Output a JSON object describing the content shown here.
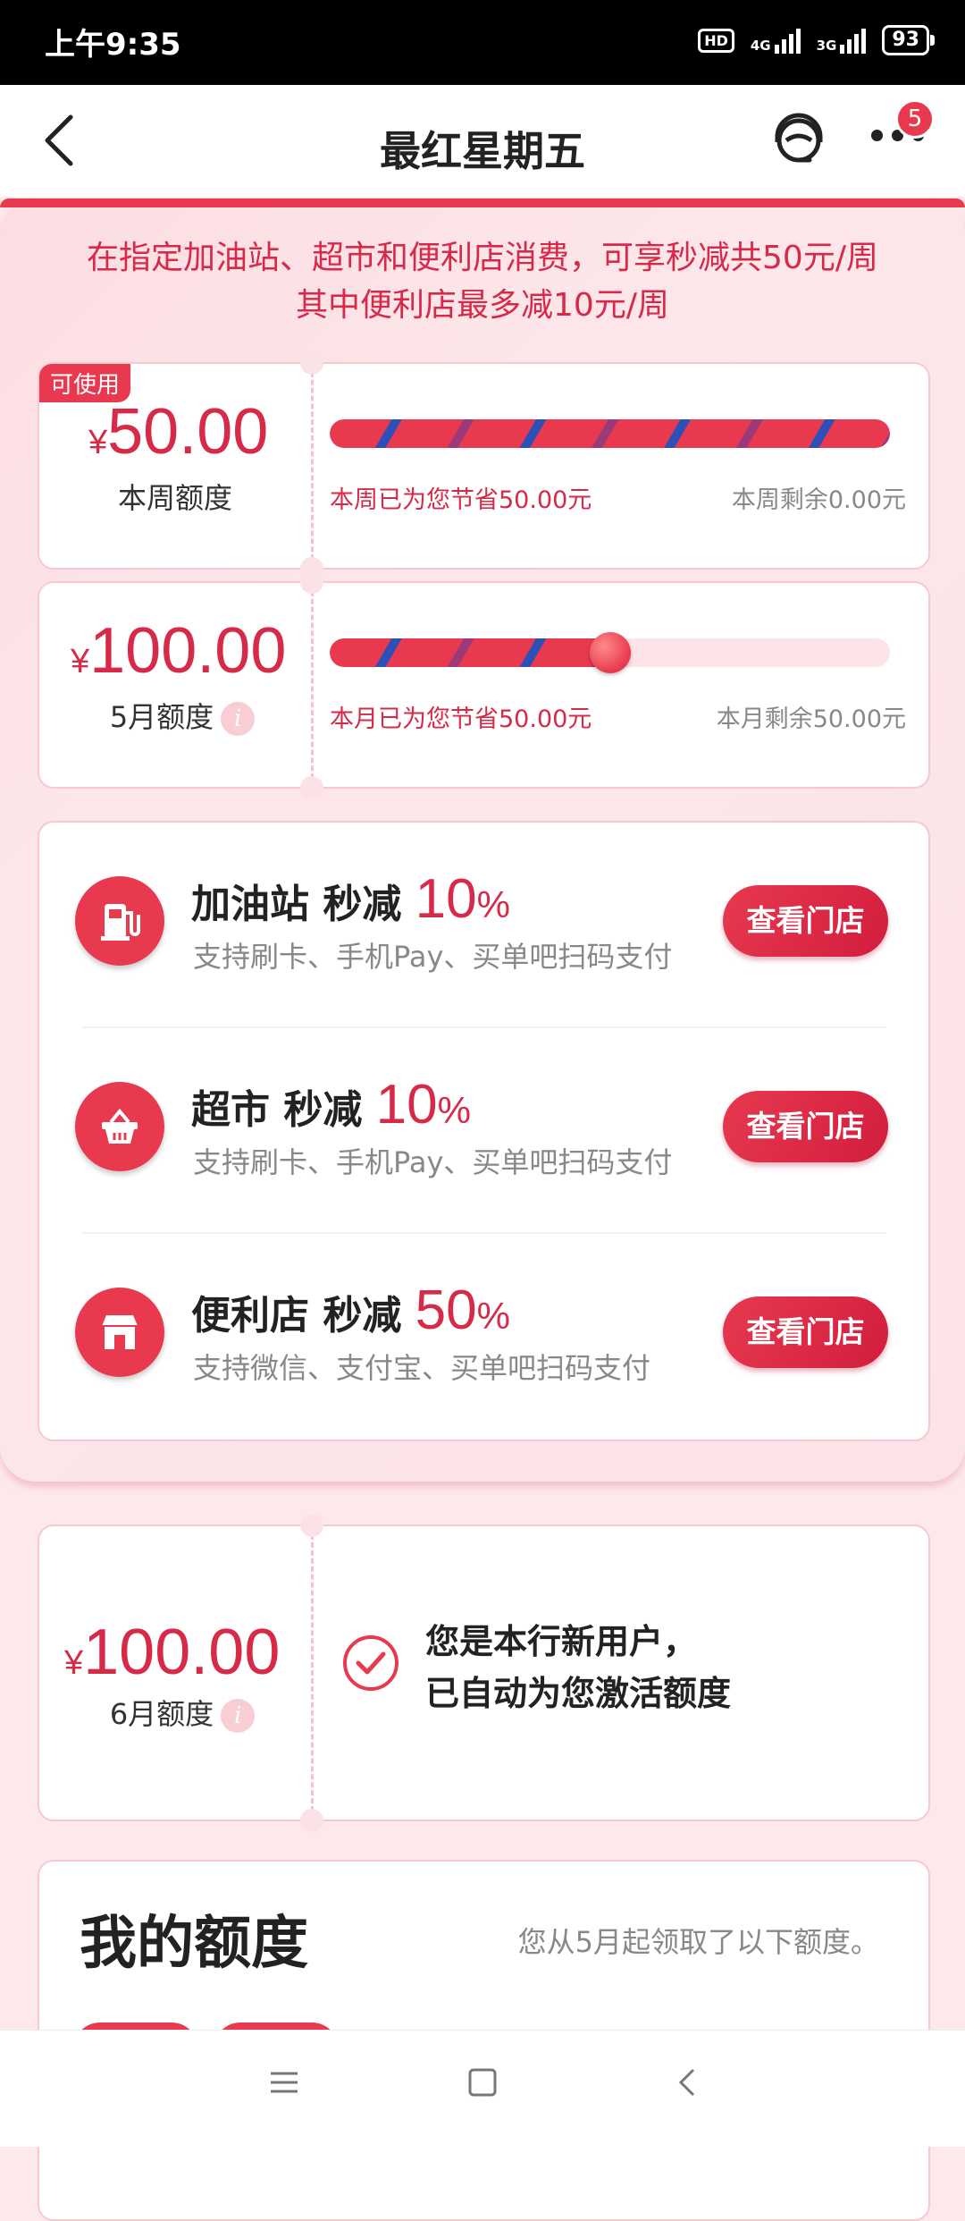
{
  "status_bar": {
    "time": "上午9:35",
    "hd": "HD",
    "net1": "4G",
    "net2": "3G",
    "battery": "93"
  },
  "nav": {
    "title": "最红星期五",
    "badge_count": "5"
  },
  "headline": {
    "line1": "在指定加油站、超市和便利店消费，可享秒减共50元/周",
    "line2": "其中便利店最多减10元/周"
  },
  "weekly": {
    "tag": "可使用",
    "yen": "¥",
    "amount": "50.00",
    "label": "本周额度",
    "saved": "本周已为您节省50.00元",
    "remain": "本周剩余0.00元",
    "progress": 1.0
  },
  "monthly": {
    "yen": "¥",
    "amount": "100.00",
    "label": "5月额度",
    "info": "i",
    "saved": "本月已为您节省50.00元",
    "remain": "本月剩余50.00元",
    "progress": 0.5
  },
  "stores": [
    {
      "name": "加油站 秒减",
      "pct": "10",
      "pct_sign": "%",
      "desc": "支持刷卡、手机Pay、买单吧扫码支付",
      "button": "查看门店",
      "icon": "gas-station-icon"
    },
    {
      "name": "超市 秒减",
      "pct": "10",
      "pct_sign": "%",
      "desc": "支持刷卡、手机Pay、买单吧扫码支付",
      "button": "查看门店",
      "icon": "basket-icon"
    },
    {
      "name": "便利店 秒减",
      "pct": "50",
      "pct_sign": "%",
      "desc": "支持微信、支付宝、买单吧扫码支付",
      "button": "查看门店",
      "icon": "store-icon"
    }
  ],
  "june": {
    "yen": "¥",
    "amount": "100.00",
    "label": "6月额度",
    "info": "i",
    "msg1": "您是本行新用户，",
    "msg2": "已自动为您激活额度"
  },
  "my_quota": {
    "title": "我的额度",
    "subtitle": "您从5月起领取了以下额度。"
  },
  "colors": {
    "accent": "#e8394f",
    "accent_text": "#d62a48",
    "stripe_blue": "#2d4fb8"
  }
}
